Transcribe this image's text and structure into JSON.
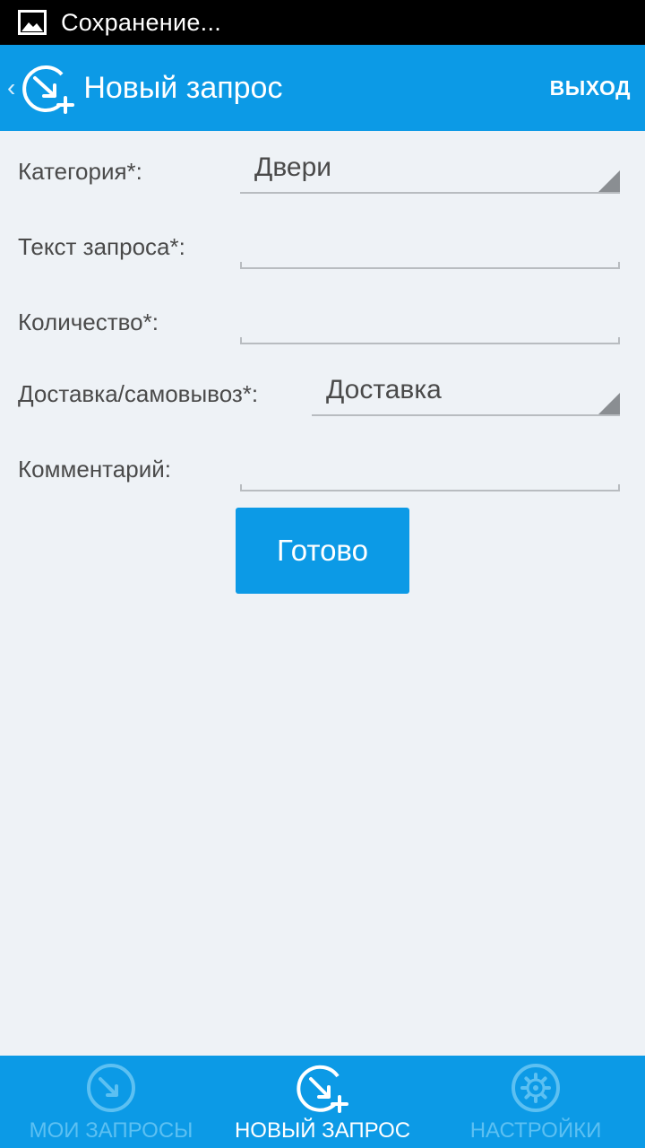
{
  "status_bar": {
    "text": "Сохранение...",
    "icon": "image-icon"
  },
  "action_bar": {
    "title": "Новый запрос",
    "logout_label": "ВЫХОД",
    "back_icon": "chevron-left-icon",
    "app_icon": "new-request-icon"
  },
  "form": {
    "category": {
      "label": "Категория*:",
      "value": "Двери"
    },
    "request_text": {
      "label": "Текст запроса*:",
      "value": ""
    },
    "quantity": {
      "label": "Количество*:",
      "value": ""
    },
    "delivery": {
      "label": "Доставка/самовывоз*:",
      "value": "Доставка"
    },
    "comment": {
      "label": "Комментарий:",
      "value": ""
    },
    "submit_label": "Готово"
  },
  "bottom_nav": {
    "items": [
      {
        "label": "МОИ ЗАПРОСЫ",
        "icon": "my-requests-icon",
        "active": false
      },
      {
        "label": "НОВЫЙ ЗАПРОС",
        "icon": "new-request-icon",
        "active": true
      },
      {
        "label": "НАСТРОЙКИ",
        "icon": "settings-gear-icon",
        "active": false
      }
    ]
  },
  "colors": {
    "accent": "#0c9ae6",
    "background": "#eef2f6",
    "inactive_nav": "#5cc0f2",
    "text": "#4a4a4a"
  }
}
